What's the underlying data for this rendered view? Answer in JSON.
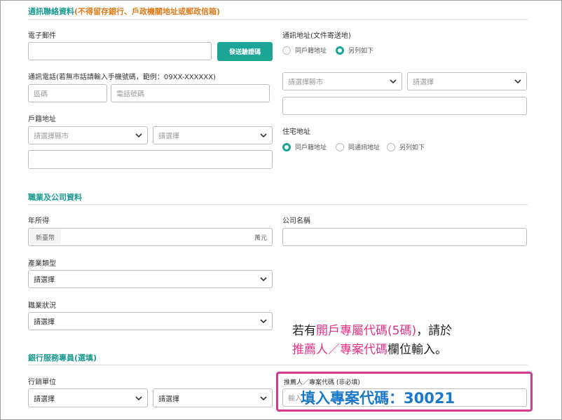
{
  "contact_section": {
    "title": "通訊聯絡資料",
    "title_note": "(不得留存銀行、戶政機關地址或郵政信箱)"
  },
  "email": {
    "label": "電子郵件",
    "value": "",
    "verify_button": "發送驗證碼"
  },
  "mailing_address": {
    "label": "通訊地址(文件寄送地)",
    "options": [
      "同戶籍地址",
      "另列如下"
    ],
    "selected": "另列如下",
    "city_placeholder": "請選擇縣市",
    "district_placeholder": "請選擇",
    "detail_value": ""
  },
  "phone": {
    "label": "通訊電話(若無市話請輸入手機號碼，範例：09XX-XXXXXX)",
    "area_placeholder": "區碼",
    "number_placeholder": "電話號碼"
  },
  "household_address": {
    "label": "戶籍地址",
    "city_placeholder": "請選擇縣市",
    "district_placeholder": "請選擇",
    "detail_value": ""
  },
  "residential_address": {
    "label": "住宅地址",
    "options": [
      "同戶籍地址",
      "同通訊地址",
      "另列如下"
    ],
    "selected": "同戶籍地址"
  },
  "job_section": {
    "title": "職業及公司資料"
  },
  "annual_income": {
    "label": "年所得",
    "prefix": "新臺幣",
    "suffix": "萬元",
    "value": ""
  },
  "company_name": {
    "label": "公司名稱",
    "value": ""
  },
  "industry": {
    "label": "產業類型",
    "value": "請選擇"
  },
  "job_status": {
    "label": "職業狀況",
    "value": "請選擇"
  },
  "specialist_section": {
    "title": "銀行服務專員(選填)"
  },
  "marketing_unit": {
    "label": "行銷單位",
    "first_value": "請選擇",
    "second_value": "請選擇"
  },
  "referrer": {
    "label": "推薦人／專案代碼 (非必填)",
    "placeholder": "輸入"
  },
  "callout": {
    "line1_pre": "若有",
    "line1_highlight": "開戶專屬代碼(5碼)",
    "line1_post": "，請於",
    "line2_highlight": "推薦人／專案代碼",
    "line2_post": "欄位輸入。",
    "project_code_text": "填入專案代碼：30021"
  },
  "colors": {
    "accent_teal": "#1aa597",
    "note_orange": "#e07b1a",
    "callout_pink": "#e0338a",
    "highlight_border": "#d23b8e",
    "code_blue": "#1a78c9"
  }
}
